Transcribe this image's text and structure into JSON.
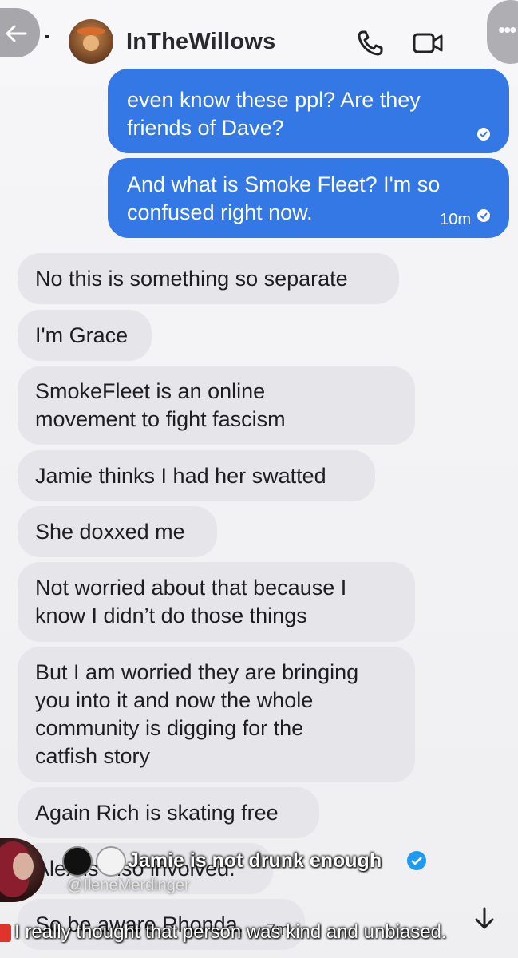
{
  "header": {
    "title": "InTheWillows",
    "back_icon": "arrow-left-icon",
    "call_icon": "phone-icon",
    "video_icon": "video-camera-icon",
    "more_icon": "more-dots-icon"
  },
  "messages": {
    "out_1_line1": "even know these ppl?  Are they",
    "out_1_line2": "friends of Dave?",
    "out_2_line1": "And what is Smoke Fleet?  I'm so",
    "out_2_line2": "confused right now.",
    "out_2_time": "10m",
    "in_1": "No this is something so separate",
    "in_2": "I'm Grace",
    "in_3_line1": "SmokeFleet is an online",
    "in_3_line2": "movement to fight fascism",
    "in_4": "Jamie thinks I had her swatted",
    "in_5": "She doxxed me",
    "in_6_line1": "Not worried about that because I",
    "in_6_line2": "know I didn’t do those things",
    "in_7_line1": "But I am worried they are bringing",
    "in_7_line2": "you into it and now the whole",
    "in_7_line3": "community is digging for the",
    "in_7_line4": "catfish story",
    "in_8": "Again Rich is skating free",
    "in_9": "Alex is also involved.",
    "in_10": "So be aware Rhonda.",
    "in_10_time": "7m"
  },
  "overlay": {
    "name": "Jamie is not drunk enough",
    "handle": "@IleneMerdinger",
    "comment": "I really thought that person was kind and unbiased."
  },
  "colors": {
    "outgoing_bubble": "#3478e6",
    "incoming_bubble": "#e6e6ea",
    "verified_badge": "#1d9bf0"
  }
}
